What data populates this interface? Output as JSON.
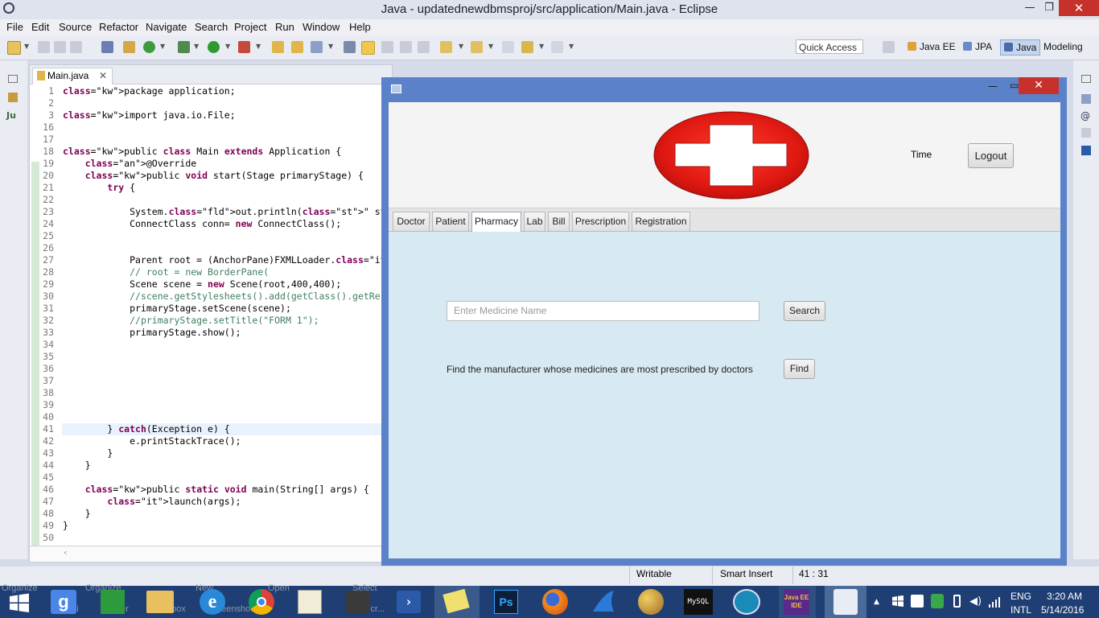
{
  "window": {
    "title": "Java - updatednewdbmsproj/src/application/Main.java - Eclipse",
    "min": "—",
    "restore": "❐",
    "close": "✕"
  },
  "menu": [
    "File",
    "Edit",
    "Source",
    "Refactor",
    "Navigate",
    "Search",
    "Project",
    "Run",
    "Window",
    "Help"
  ],
  "toolbar": {
    "quick_access": "Quick Access"
  },
  "perspectives": [
    {
      "label": "Java EE",
      "icon": "java-ee-perspective-icon"
    },
    {
      "label": "JPA",
      "icon": "jpa-perspective-icon"
    },
    {
      "label": "Java",
      "icon": "java-perspective-icon"
    },
    {
      "label": "Modeling",
      "icon": "modeling-perspective-icon"
    }
  ],
  "editor": {
    "tab_label": "Main.java",
    "lines": [
      {
        "n": "1",
        "t": "package application;"
      },
      {
        "n": "2",
        "t": ""
      },
      {
        "n": "3",
        "t": "import java.io.File;"
      },
      {
        "n": "16",
        "t": ""
      },
      {
        "n": "17",
        "t": ""
      },
      {
        "n": "18",
        "t": "public class Main extends Application {"
      },
      {
        "n": "19",
        "t": "    @Override"
      },
      {
        "n": "20",
        "t": "    public void start(Stage primaryStage) {"
      },
      {
        "n": "21",
        "t": "        try {"
      },
      {
        "n": "22",
        "t": ""
      },
      {
        "n": "23",
        "t": "            System.out.println(\" started  \");"
      },
      {
        "n": "24",
        "t": "            ConnectClass conn= new ConnectClass();"
      },
      {
        "n": "25",
        "t": ""
      },
      {
        "n": "26",
        "t": ""
      },
      {
        "n": "27",
        "t": "            Parent root = (AnchorPane)FXMLLoader.load(Mai"
      },
      {
        "n": "28",
        "t": "            // root = new BorderPane("
      },
      {
        "n": "29",
        "t": "            Scene scene = new Scene(root,400,400);"
      },
      {
        "n": "30",
        "t": "            //scene.getStylesheets().add(getClass().getRe"
      },
      {
        "n": "31",
        "t": "            primaryStage.setScene(scene);"
      },
      {
        "n": "32",
        "t": "            //primaryStage.setTitle(\"FORM 1\");"
      },
      {
        "n": "33",
        "t": "            primaryStage.show();"
      },
      {
        "n": "34",
        "t": ""
      },
      {
        "n": "35",
        "t": ""
      },
      {
        "n": "36",
        "t": ""
      },
      {
        "n": "37",
        "t": ""
      },
      {
        "n": "38",
        "t": ""
      },
      {
        "n": "39",
        "t": ""
      },
      {
        "n": "40",
        "t": ""
      },
      {
        "n": "41",
        "t": "        } catch(Exception e) {"
      },
      {
        "n": "42",
        "t": "            e.printStackTrace();"
      },
      {
        "n": "43",
        "t": "        }"
      },
      {
        "n": "44",
        "t": "    }"
      },
      {
        "n": "45",
        "t": ""
      },
      {
        "n": "46",
        "t": "    public static void main(String[] args) {"
      },
      {
        "n": "47",
        "t": "        launch(args);"
      },
      {
        "n": "48",
        "t": "    }"
      },
      {
        "n": "49",
        "t": "}"
      },
      {
        "n": "50",
        "t": ""
      }
    ]
  },
  "app": {
    "time_label": "Time",
    "logout_label": "Logout",
    "tabs": [
      "Doctor",
      "Patient",
      "Pharmacy",
      "Lab",
      "Bill",
      "Prescription",
      "Registration"
    ],
    "active_tab": "Pharmacy",
    "search_placeholder": "Enter Medicine Name",
    "search_label": "Search",
    "find_text": "Find the manufacturer whose medicines are most prescribed by doctors",
    "find_label": "Find",
    "colors": {
      "logo_red": "#e01a12",
      "content_bg": "#d7e9f3",
      "window_frame": "#5b82c9"
    }
  },
  "status": {
    "writable": "Writable",
    "insert_mode": "Smart Insert",
    "position": "41 : 31"
  },
  "taskbar": {
    "ghost_labels": [
      "Organize",
      "New",
      "Open",
      "Select",
      "akshi",
      "er",
      "box",
      "creenshots",
      "Scr..."
    ],
    "tray": {
      "language": "ENG",
      "layout": "INTL",
      "time": "3:20 AM",
      "date": "5/14/2016"
    }
  }
}
